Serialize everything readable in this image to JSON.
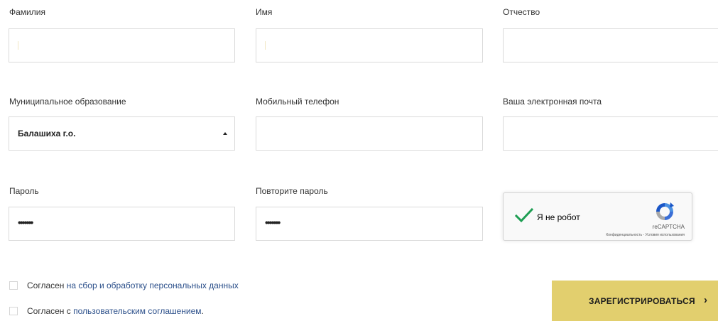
{
  "form": {
    "last_name": {
      "label": "Фамилия",
      "value": ""
    },
    "first_name": {
      "label": "Имя",
      "value": ""
    },
    "patronymic": {
      "label": "Отчество",
      "value": ""
    },
    "municipality": {
      "label": "Муниципальное образование",
      "selected": "Балашиха г.о."
    },
    "phone": {
      "label": "Мобильный телефон",
      "value": ""
    },
    "email": {
      "label": "Ваша электронная почта",
      "value": ""
    },
    "password": {
      "label": "Пароль",
      "masked_value": "•••••••"
    },
    "password_repeat": {
      "label": "Повторите пароль",
      "masked_value": "•••••••"
    }
  },
  "captcha": {
    "label": "Я не робот",
    "brand": "reCAPTCHA",
    "privacy_link": "Конфиденциальность",
    "separator": " - ",
    "terms_link": "Условия использования",
    "checked": true,
    "check_color": "#1e9e53"
  },
  "consents": [
    {
      "prefix": "Согласен ",
      "link": "на сбор и обработку персональных данных",
      "suffix": "",
      "checked": false
    },
    {
      "prefix": "Согласен с ",
      "link": "пользовательским соглашением",
      "suffix": ".",
      "checked": false
    }
  ],
  "register_button": {
    "label": "ЗАРЕГИСТРИРОВАТЬСЯ",
    "chevron": "›",
    "color": "#e2cf6e"
  }
}
